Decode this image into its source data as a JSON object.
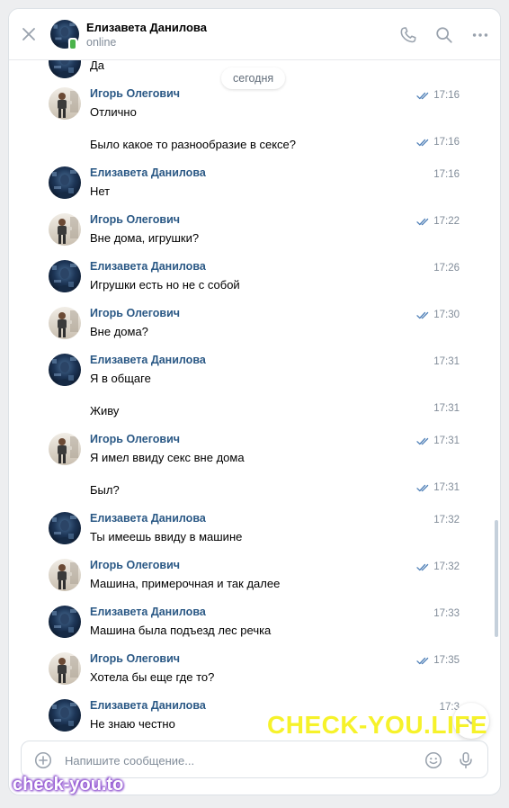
{
  "header": {
    "name": "Елизавета Данилова",
    "status": "online"
  },
  "date_divider": "сегодня",
  "messages": [
    {
      "text": "Да"
    },
    {
      "author": "Игорь Олегович",
      "text": "Отлично",
      "time": "17:16",
      "read": true
    },
    {
      "text": "Было какое то разнообразие в сексе?",
      "time": "17:16",
      "read": true
    },
    {
      "author": "Елизавета Данилова",
      "text": "Нет",
      "time": "17:16"
    },
    {
      "author": "Игорь Олегович",
      "text": "Вне дома, игрушки?",
      "time": "17:22",
      "read": true
    },
    {
      "author": "Елизавета Данилова",
      "text": "Игрушки есть но не с собой",
      "time": "17:26"
    },
    {
      "author": "Игорь Олегович",
      "text": "Вне дома?",
      "time": "17:30",
      "read": true
    },
    {
      "author": "Елизавета Данилова",
      "text": "Я в общаге",
      "time": "17:31"
    },
    {
      "text": "Живу",
      "time": "17:31"
    },
    {
      "author": "Игорь Олегович",
      "text": "Я имел ввиду секс вне дома",
      "time": "17:31",
      "read": true
    },
    {
      "text": "Был?",
      "time": "17:31",
      "read": true
    },
    {
      "author": "Елизавета Данилова",
      "text": "Ты имеешь ввиду в машине",
      "time": "17:32"
    },
    {
      "author": "Игорь Олегович",
      "text": "Машина, примерочная и так далее",
      "time": "17:32",
      "read": true
    },
    {
      "author": "Елизавета Данилова",
      "text": "Машина была подъезд лес речка",
      "time": "17:33"
    },
    {
      "author": "Игорь Олегович",
      "text": "Хотела бы еще где то?",
      "time": "17:35",
      "read": true
    },
    {
      "author": "Елизавета Данилова",
      "text": "Не знаю честно",
      "time": "17:3"
    }
  ],
  "composer": {
    "placeholder": "Напишите сообщение..."
  },
  "watermarks": {
    "big": "CHECK-YOU.LIFE",
    "small": "check-you.to"
  },
  "colors": {
    "accent": "#2a5885",
    "muted": "#818c99",
    "check": "#5181b8",
    "online": "#4bb34b",
    "watermark_yellow": "#f6f22a",
    "watermark_purple": "#9a5cd8"
  }
}
